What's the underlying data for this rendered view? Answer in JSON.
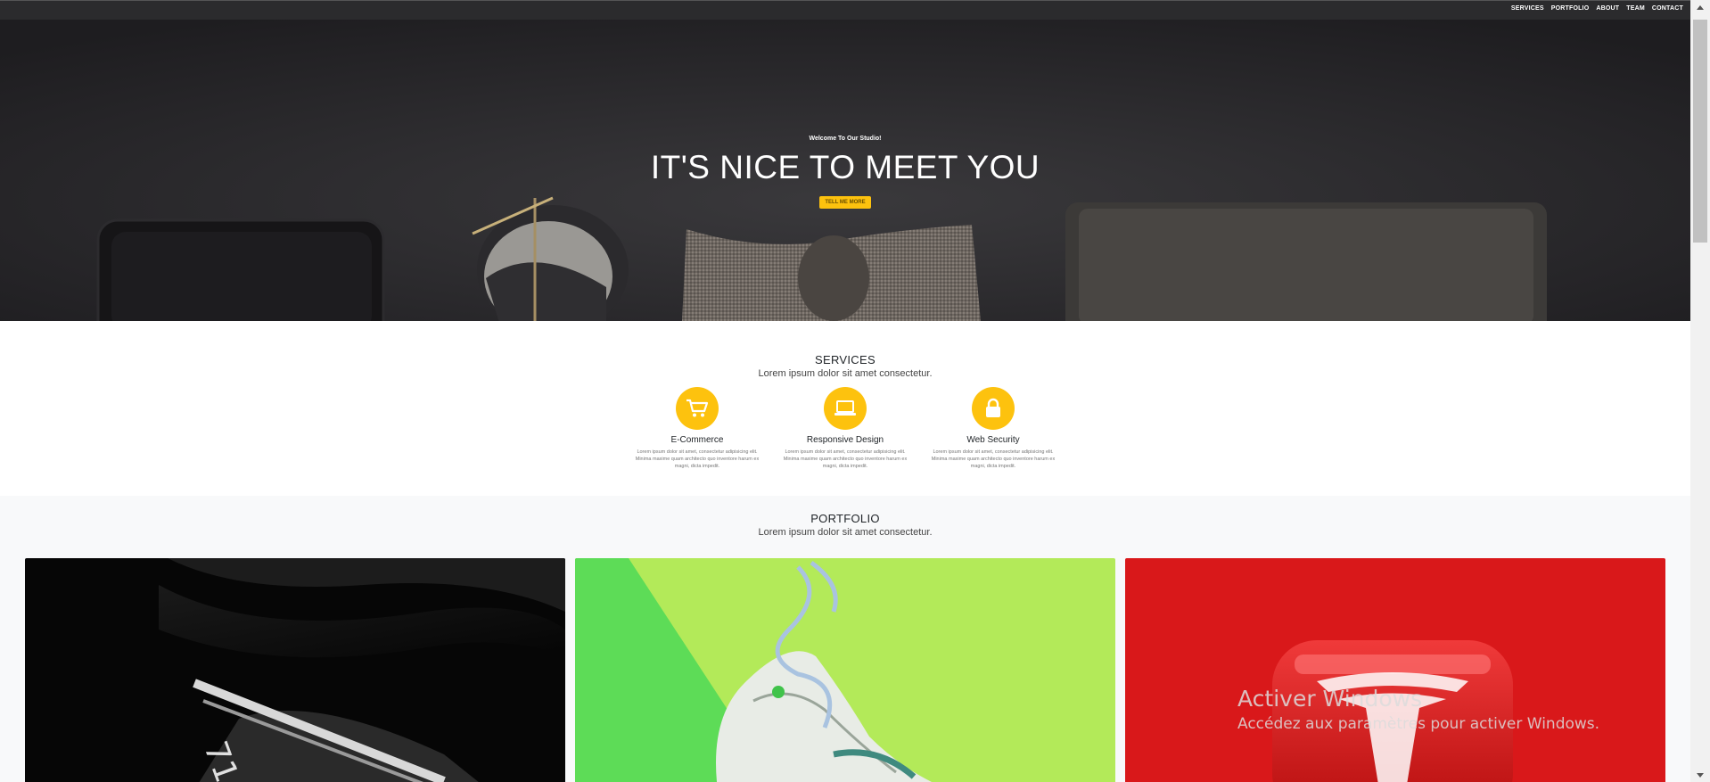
{
  "navbar": {
    "links": [
      "SERVICES",
      "PORTFOLIO",
      "ABOUT",
      "TEAM",
      "CONTACT"
    ]
  },
  "hero": {
    "subheading": "Welcome To Our Studio!",
    "heading": "IT'S NICE TO MEET YOU",
    "button_label": "TELL ME MORE"
  },
  "services": {
    "title": "SERVICES",
    "subtitle": "Lorem ipsum dolor sit amet consectetur.",
    "items": [
      {
        "icon": "shopping-cart-icon",
        "title": "E-Commerce",
        "text": "Lorem ipsum dolor sit amet, consectetur adipisicing elit. Minima maxime quam architecto quo inventore harum ex magni, dicta impedit."
      },
      {
        "icon": "laptop-icon",
        "title": "Responsive Design",
        "text": "Lorem ipsum dolor sit amet, consectetur adipisicing elit. Minima maxime quam architecto quo inventore harum ex magni, dicta impedit."
      },
      {
        "icon": "lock-icon",
        "title": "Web Security",
        "text": "Lorem ipsum dolor sit amet, consectetur adipisicing elit. Minima maxime quam architecto quo inventore harum ex magni, dicta impedit."
      }
    ]
  },
  "portfolio": {
    "title": "PORTFOLIO",
    "subtitle": "Lorem ipsum dolor sit amet consectetur."
  },
  "watermark": {
    "title": "Activer Windows",
    "subtitle": "Accédez aux paramètres pour activer Windows."
  },
  "colors": {
    "accent": "#fdc20e",
    "navbar": "#2b2b2d",
    "hero_bg": "#2a292c"
  }
}
